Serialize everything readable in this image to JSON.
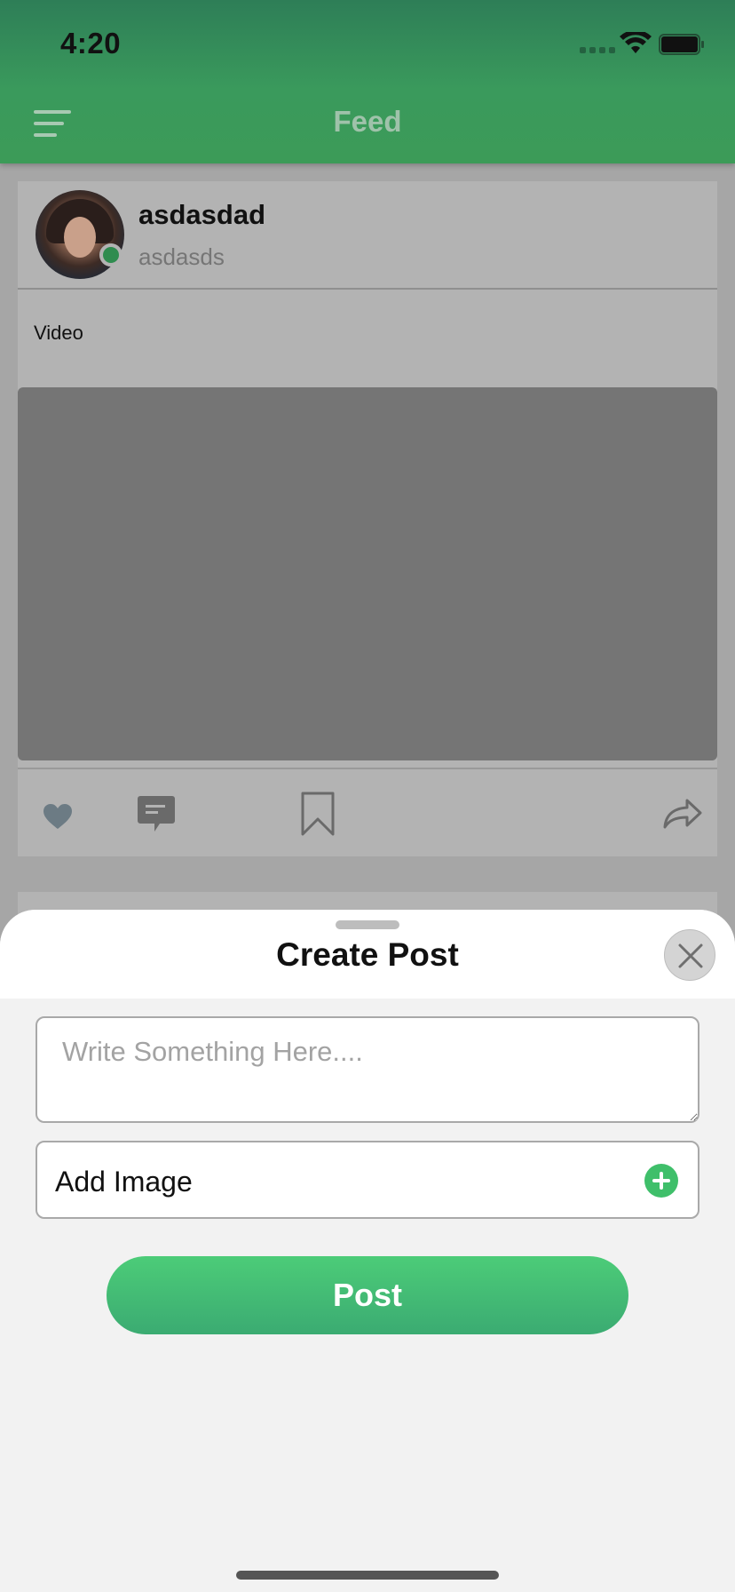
{
  "status_bar": {
    "time": "4:20"
  },
  "header": {
    "title": "Feed"
  },
  "post": {
    "username": "asdasdad",
    "handle": "asdasds",
    "text": "Video"
  },
  "create_post": {
    "title": "Create Post",
    "input_placeholder": "Write Something Here....",
    "add_image_label": "Add Image",
    "post_button_label": "Post"
  },
  "colors": {
    "brand_green": "#3c9b58",
    "accent_green": "#3fbf6a"
  },
  "icons": [
    "menu-icon",
    "heart-icon",
    "comment-icon",
    "bookmark-icon",
    "share-icon",
    "close-icon",
    "add-icon",
    "wifi-icon",
    "battery-icon"
  ]
}
